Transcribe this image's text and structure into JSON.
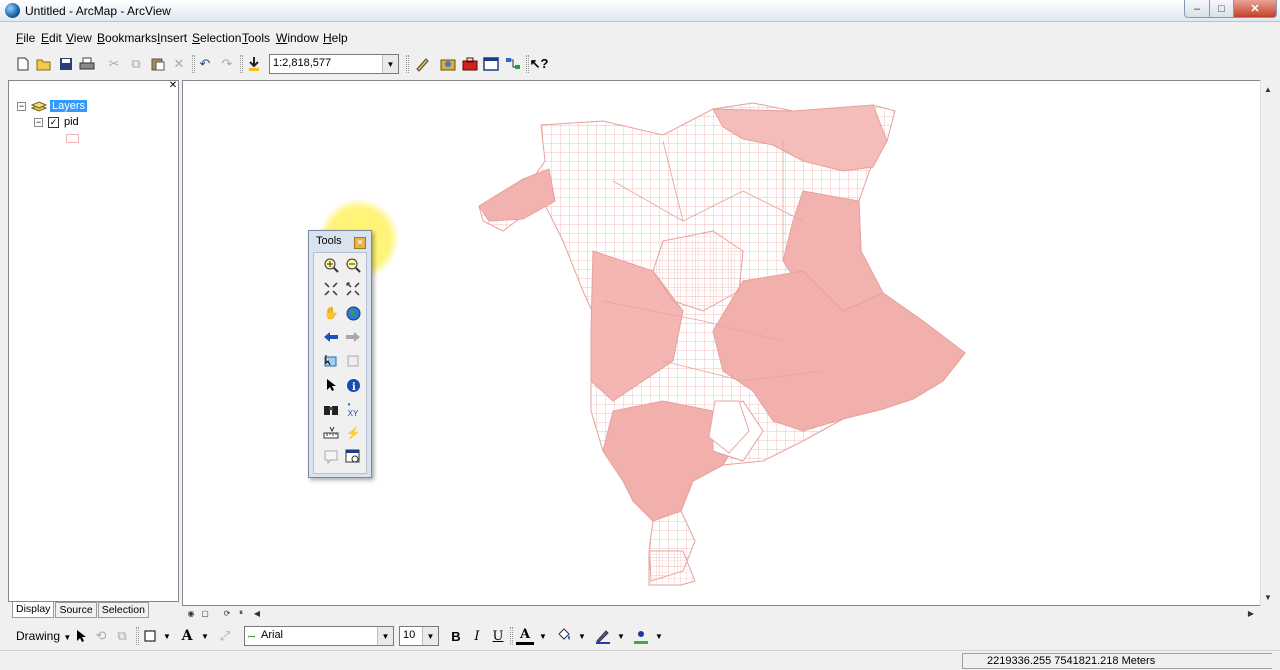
{
  "window": {
    "title": "Untitled - ArcMap - ArcView",
    "min": "–",
    "max": "□",
    "close": "✕"
  },
  "menu": [
    {
      "u": "F",
      "rest": "ile"
    },
    {
      "u": "E",
      "rest": "dit"
    },
    {
      "u": "V",
      "rest": "iew"
    },
    {
      "u": "B",
      "rest": "ookmarks"
    },
    {
      "u": "I",
      "rest": "nsert"
    },
    {
      "u": "S",
      "rest": "election"
    },
    {
      "u": "T",
      "rest": "ools"
    },
    {
      "u": "W",
      "rest": "indow"
    },
    {
      "u": "H",
      "rest": "elp"
    }
  ],
  "standard_toolbar": {
    "scale": "1:2,818,577"
  },
  "toc": {
    "root": "Layers",
    "layer": "pid",
    "layer_checked": "✓",
    "tabs": [
      "Display",
      "Source",
      "Selection"
    ],
    "close": "✕"
  },
  "tools_window": {
    "title": "Tools"
  },
  "drawing_toolbar": {
    "label": "Drawing",
    "font": "Arial",
    "size": "10",
    "bold": "B",
    "italic": "I",
    "underline": "U",
    "text_tool": "A",
    "font_color_label": "A"
  },
  "status": {
    "coordinates": "2219336.255  7541821.218 Meters"
  },
  "colors": {
    "map_fill": "#f2b3b0",
    "map_stroke": "#e8a09c",
    "selection": "#3399ff"
  }
}
